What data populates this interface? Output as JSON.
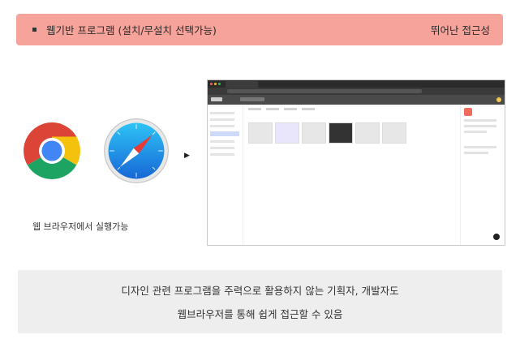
{
  "banner": {
    "title": "웹기반 프로그램 (설치/무설치 선택가능)",
    "tag": "뛰어난 접근성"
  },
  "browsers": {
    "icons": [
      "chrome-icon",
      "safari-icon"
    ],
    "caption": "웹 브라우저에서 실행가능"
  },
  "screenshot": {
    "description_icon": "arrow-right-icon"
  },
  "info": {
    "line1": "디자인 관련 프로그램을 주력으로 활용하지 않는 기획자, 개발자도",
    "line2": "웹브라우저를 통해 쉽게 접근할 수 있음"
  },
  "colors": {
    "banner_bg": "#f6a49b",
    "info_bg": "#eeeeee"
  }
}
